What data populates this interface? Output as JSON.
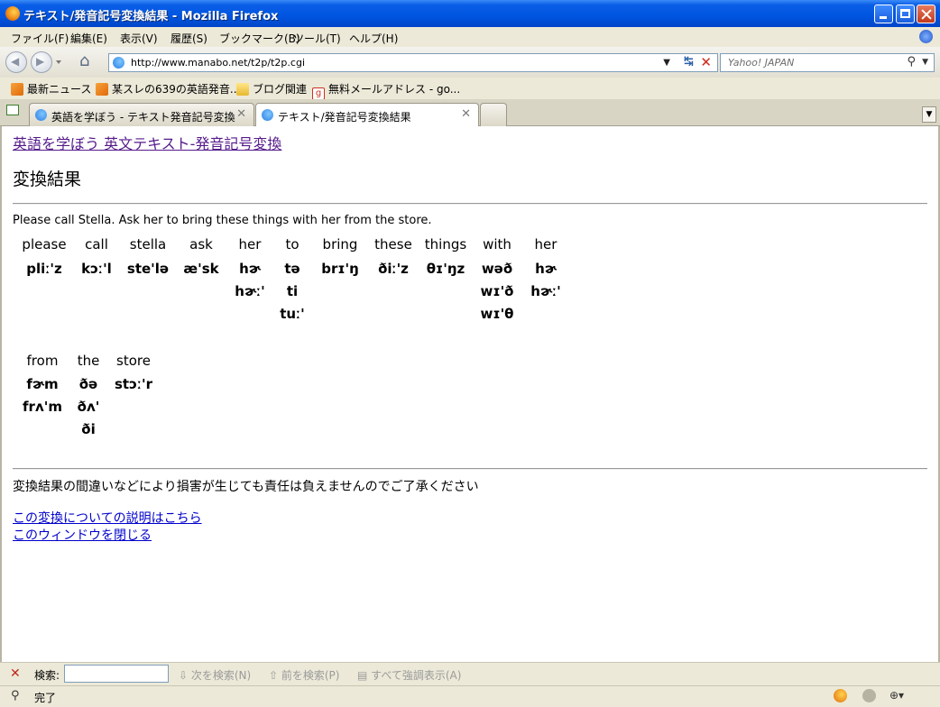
{
  "window": {
    "title": "テキスト/発音記号変換結果 - Mozilla Firefox"
  },
  "menu": [
    "ファイル(F)",
    "編集(E)",
    "表示(V)",
    "履歴(S)",
    "ブックマーク(B)",
    "ツール(T)",
    "ヘルプ(H)"
  ],
  "nav": {
    "url": "http://www.manabo.net/t2p/t2p.cgi",
    "search_placeholder": "Yahoo! JAPAN"
  },
  "bookmarks": [
    "最新ニュース",
    "某スレの639の英語発音...",
    "ブログ関連",
    "無料メールアドレス - go..."
  ],
  "tabs": [
    {
      "label": "英語を学ぼう - テキスト発音記号変換"
    },
    {
      "label": "テキスト/発音記号変換結果"
    }
  ],
  "page": {
    "top_link": "英語を学ぼう 英文テキスト-発音記号変換",
    "heading": "変換結果",
    "sentence": "Please call Stella. Ask her to bring these things with her from the store.",
    "rows": [
      [
        {
          "word": "please",
          "ipa": [
            "pliː'z"
          ]
        },
        {
          "word": "call",
          "ipa": [
            "kɔː'l"
          ]
        },
        {
          "word": "stella",
          "ipa": [
            "ste'lə"
          ]
        },
        {
          "word": "ask",
          "ipa": [
            "æ'sk"
          ]
        },
        {
          "word": "her",
          "ipa": [
            "hɚ",
            "hɚː'"
          ]
        },
        {
          "word": "to",
          "ipa": [
            "tə",
            "ti",
            "tuː'"
          ]
        },
        {
          "word": "bring",
          "ipa": [
            "brɪ'ŋ"
          ]
        },
        {
          "word": "these",
          "ipa": [
            "ðiː'z"
          ]
        },
        {
          "word": "things",
          "ipa": [
            "θɪ'ŋz"
          ]
        },
        {
          "word": "with",
          "ipa": [
            "wəð",
            "wɪ'ð",
            "wɪ'θ"
          ]
        },
        {
          "word": "her",
          "ipa": [
            "hɚ",
            "hɚː'"
          ]
        }
      ],
      [
        {
          "word": "from",
          "ipa": [
            "fɚm",
            "frʌ'm"
          ]
        },
        {
          "word": "the",
          "ipa": [
            "ðə",
            "ðʌ'",
            "ði"
          ]
        },
        {
          "word": "store",
          "ipa": [
            "stɔː'r"
          ]
        }
      ]
    ],
    "disclaimer": "変換結果の間違いなどにより損害が生じても責任は負えませんのでご了承ください",
    "links": [
      "この変換についての説明はこちら",
      "このウィンドウを閉じる"
    ]
  },
  "findbar": {
    "label": "検索:",
    "next": "次を検索(N)",
    "prev": "前を検索(P)",
    "highlight": "すべて強調表示(A)"
  },
  "status": {
    "text": "完了"
  },
  "colors": {
    "titlebar": "#0055e0",
    "visited_link": "#551a8b",
    "link": "#0000cc"
  }
}
